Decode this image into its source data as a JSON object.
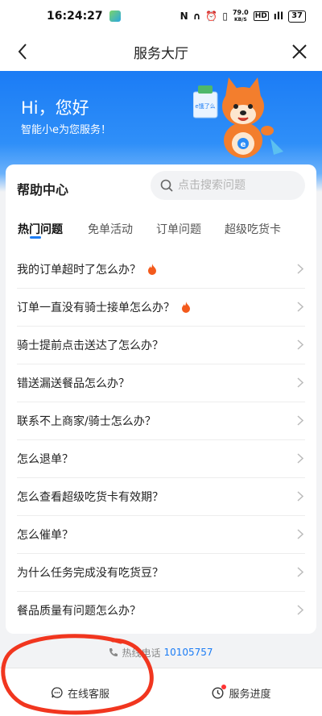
{
  "status_bar": {
    "time": "16:24:27",
    "net_speed": "79.0",
    "net_unit": "KB/S",
    "signal": "HD",
    "battery": "37"
  },
  "nav": {
    "title": "服务大厅",
    "back_icon": "chevron-left-icon",
    "close_icon": "close-icon"
  },
  "hero": {
    "greeting": "Hi，您好",
    "subtitle": "智能小e为您服务！",
    "mascot_bag_text": "e饿了么"
  },
  "help_center": {
    "title": "帮助中心",
    "search_placeholder": "点击搜索问题",
    "tabs": [
      {
        "label": "热门问题",
        "active": true
      },
      {
        "label": "免单活动",
        "active": false
      },
      {
        "label": "订单问题",
        "active": false
      },
      {
        "label": "超级吃货卡",
        "active": false
      }
    ],
    "questions": [
      {
        "text": "我的订单超时了怎么办？",
        "hot": true
      },
      {
        "text": "订单一直没有骑士接单怎么办？",
        "hot": true
      },
      {
        "text": "骑士提前点击送达了怎么办？",
        "hot": false
      },
      {
        "text": "错送漏送餐品怎么办？",
        "hot": false
      },
      {
        "text": "联系不上商家/骑士怎么办？",
        "hot": false
      },
      {
        "text": "怎么退单？",
        "hot": false
      },
      {
        "text": "怎么查看超级吃货卡有效期？",
        "hot": false
      },
      {
        "text": "怎么催单？",
        "hot": false
      },
      {
        "text": "为什么任务完成没有吃货豆？",
        "hot": false
      },
      {
        "text": "餐品质量有问题怎么办？",
        "hot": false
      }
    ]
  },
  "hotline": {
    "label": "热线电话",
    "number": "10105757"
  },
  "bottom_bar": {
    "online_service": "在线客服",
    "service_progress": "服务进度"
  },
  "colors": {
    "accent": "#1b7cf5",
    "hot_icon": "#f35a1c",
    "annotation_circle": "#f1361f"
  }
}
